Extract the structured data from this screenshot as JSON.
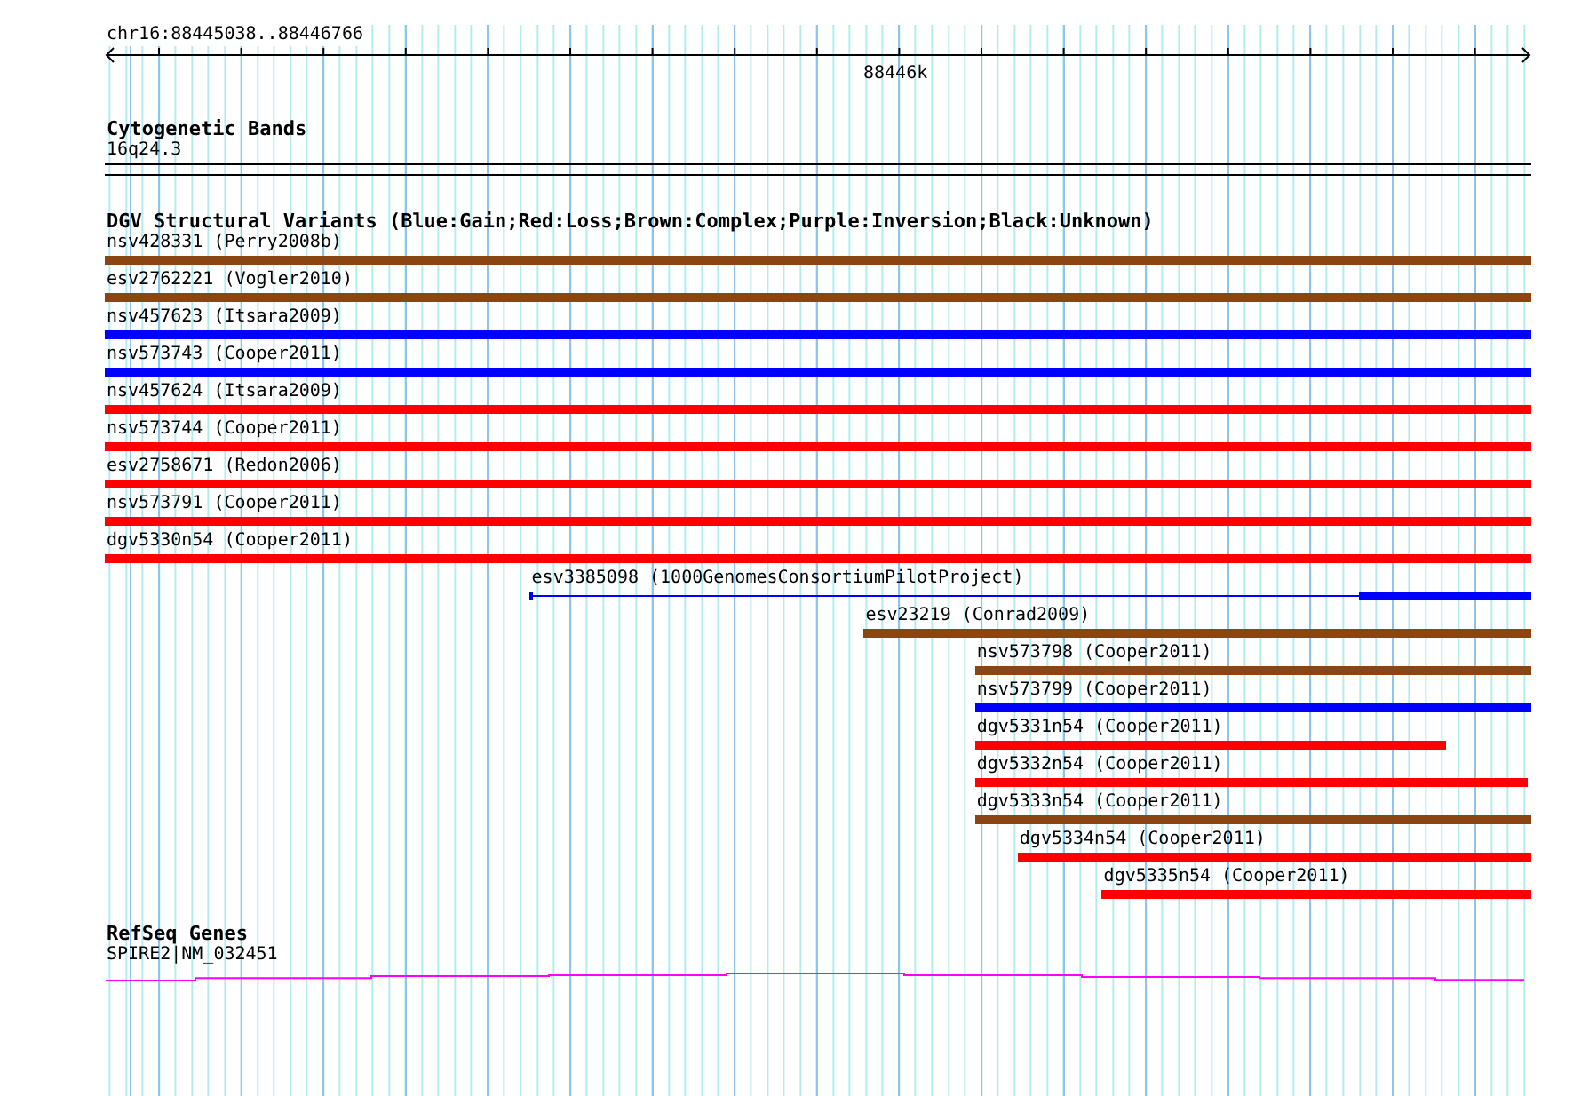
{
  "ruler": {
    "range": "chr16:88445038..88446766",
    "tick_label": "88446k"
  },
  "tracks": [
    {
      "kind": "bands",
      "title": "Cytogenetic Bands",
      "items": [
        {
          "label": "16q24.3"
        }
      ]
    },
    {
      "kind": "variants",
      "title": "DGV Structural Variants (Blue:Gain;Red:Loss;Brown:Complex;Purple:Inversion;Black:Unknown)",
      "items": [
        {
          "label": "nsv428331 (Perry2008b)",
          "color": "#8b4513",
          "kind": "solid"
        },
        {
          "label": "esv2762221 (Vogler2010)",
          "color": "#8b4513",
          "kind": "solid"
        },
        {
          "label": "nsv457623 (Itsara2009)",
          "color": "#0000ff",
          "kind": "solid"
        },
        {
          "label": "nsv573743 (Cooper2011)",
          "color": "#0000ff",
          "kind": "solid"
        },
        {
          "label": "nsv457624 (Itsara2009)",
          "color": "#ff0000",
          "kind": "solid"
        },
        {
          "label": "nsv573744 (Cooper2011)",
          "color": "#ff0000",
          "kind": "solid"
        },
        {
          "label": "esv2758671 (Redon2006)",
          "color": "#ff0000",
          "kind": "solid"
        },
        {
          "label": "nsv573791 (Cooper2011)",
          "color": "#ff0000",
          "kind": "solid"
        },
        {
          "label": "dgv5330n54 (Cooper2011)",
          "color": "#ff0000",
          "kind": "solid"
        },
        {
          "label": "esv3385098 (1000GenomesConsortiumPilotProject)",
          "color": "#0000ff",
          "kind": "split"
        },
        {
          "label": "esv23219 (Conrad2009)",
          "color": "#8b4513",
          "kind": "solid"
        },
        {
          "label": "nsv573798 (Cooper2011)",
          "color": "#8b4513",
          "kind": "solid"
        },
        {
          "label": "nsv573799 (Cooper2011)",
          "color": "#0000ff",
          "kind": "solid"
        },
        {
          "label": "dgv5331n54 (Cooper2011)",
          "color": "#ff0000",
          "kind": "solid"
        },
        {
          "label": "dgv5332n54 (Cooper2011)",
          "color": "#ff0000",
          "kind": "solid"
        },
        {
          "label": "dgv5333n54 (Cooper2011)",
          "color": "#8b4513",
          "kind": "solid"
        },
        {
          "label": "dgv5334n54 (Cooper2011)",
          "color": "#ff0000",
          "kind": "solid"
        },
        {
          "label": "dgv5335n54 (Cooper2011)",
          "color": "#ff0000",
          "kind": "solid"
        }
      ]
    },
    {
      "kind": "genes",
      "title": "RefSeq Genes",
      "items": [
        {
          "label": "SPIRE2|NM_032451"
        }
      ]
    }
  ]
}
